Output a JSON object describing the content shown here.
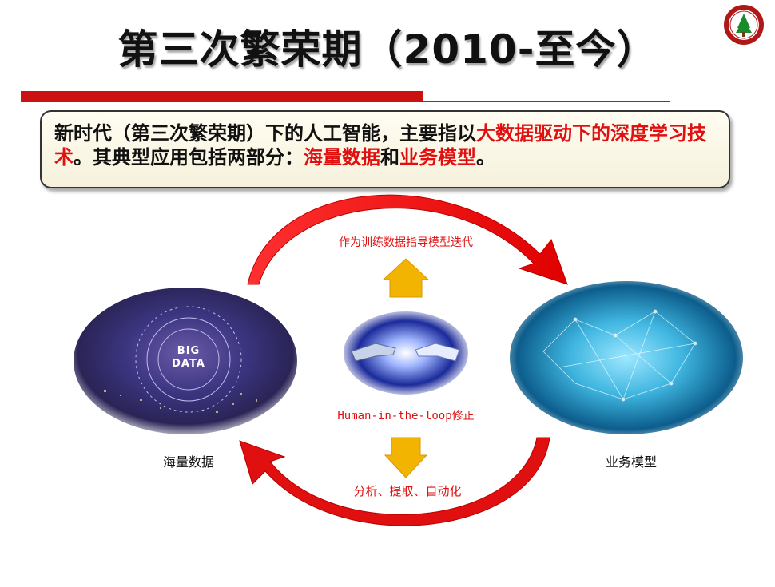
{
  "title": "第三次繁荣期（2010-至今）",
  "logo": {
    "icon": "university-seal-logo"
  },
  "callout": {
    "p1": "新时代（第三次繁荣期）下的人工智能，主要指以",
    "p2": "大数据驱动下的深度学习技术",
    "p3": "。其典型应用包括两部分：",
    "p4": "海量数据",
    "p5": "和",
    "p6": "业务模型",
    "p7": "。"
  },
  "diagram": {
    "big_data_label": "BIG\nDATA",
    "top_arrow_label": "作为训练数据指导模型迭代",
    "center_label": "Human-in-the-loop修正",
    "bottom_arrow_label": "分析、提取、自动化",
    "left_caption": "海量数据",
    "right_caption": "业务模型"
  },
  "colors": {
    "accent_red": "#e01010",
    "arrow_yellow": "#f2b400",
    "rule_red": "#cc1111"
  }
}
